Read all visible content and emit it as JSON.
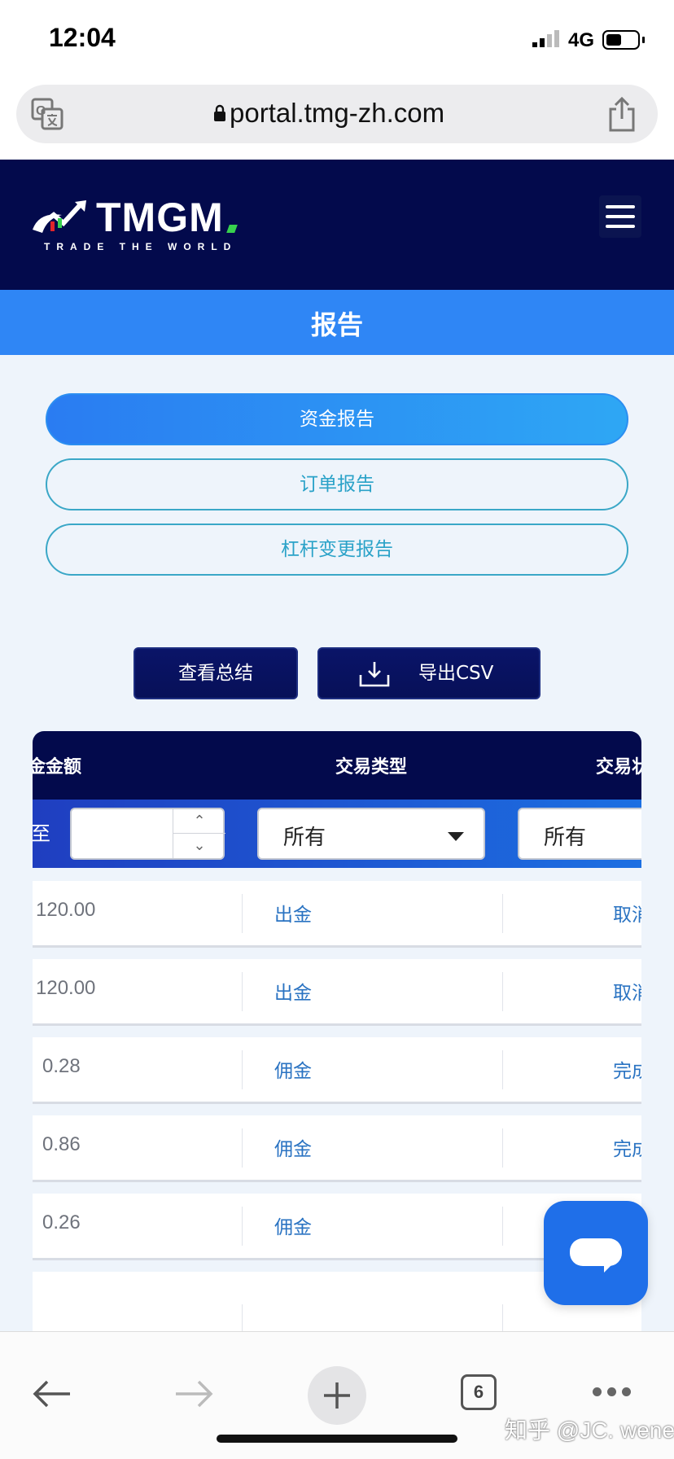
{
  "status_bar": {
    "time": "12:04",
    "network": "4G"
  },
  "browser": {
    "url": "portal.tmg-zh.com",
    "tab_count": "6"
  },
  "header": {
    "logo_text": "TMGM",
    "tagline": "TRADE THE WORLD"
  },
  "page": {
    "title": "报告"
  },
  "reports": [
    {
      "label": "资金报告",
      "active": true
    },
    {
      "label": "订单报告",
      "active": false
    },
    {
      "label": "杠杆变更报告",
      "active": false
    }
  ],
  "actions": {
    "summary_label": "查看总结",
    "export_label": "导出CSV"
  },
  "table": {
    "headers": {
      "amount": "金金额",
      "type": "交易类型",
      "status": "交易状"
    },
    "filters": {
      "label": "至",
      "type_select": "所有",
      "status_select": "所有"
    },
    "rows": [
      {
        "amount": "120.00",
        "type": "出金",
        "status": "取消"
      },
      {
        "amount": "120.00",
        "type": "出金",
        "status": "取消"
      },
      {
        "amount": "0.28",
        "type": "佣金",
        "status": "完成"
      },
      {
        "amount": "0.86",
        "type": "佣金",
        "status": "完成"
      },
      {
        "amount": "0.26",
        "type": "佣金",
        "status": ""
      }
    ]
  },
  "watermark": "知乎 @JC. wenex",
  "colors": {
    "header_bg": "#030a4c",
    "accent_blue": "#2f86f5",
    "link_blue": "#2a73c2",
    "outline_teal": "#3aa7c7"
  }
}
